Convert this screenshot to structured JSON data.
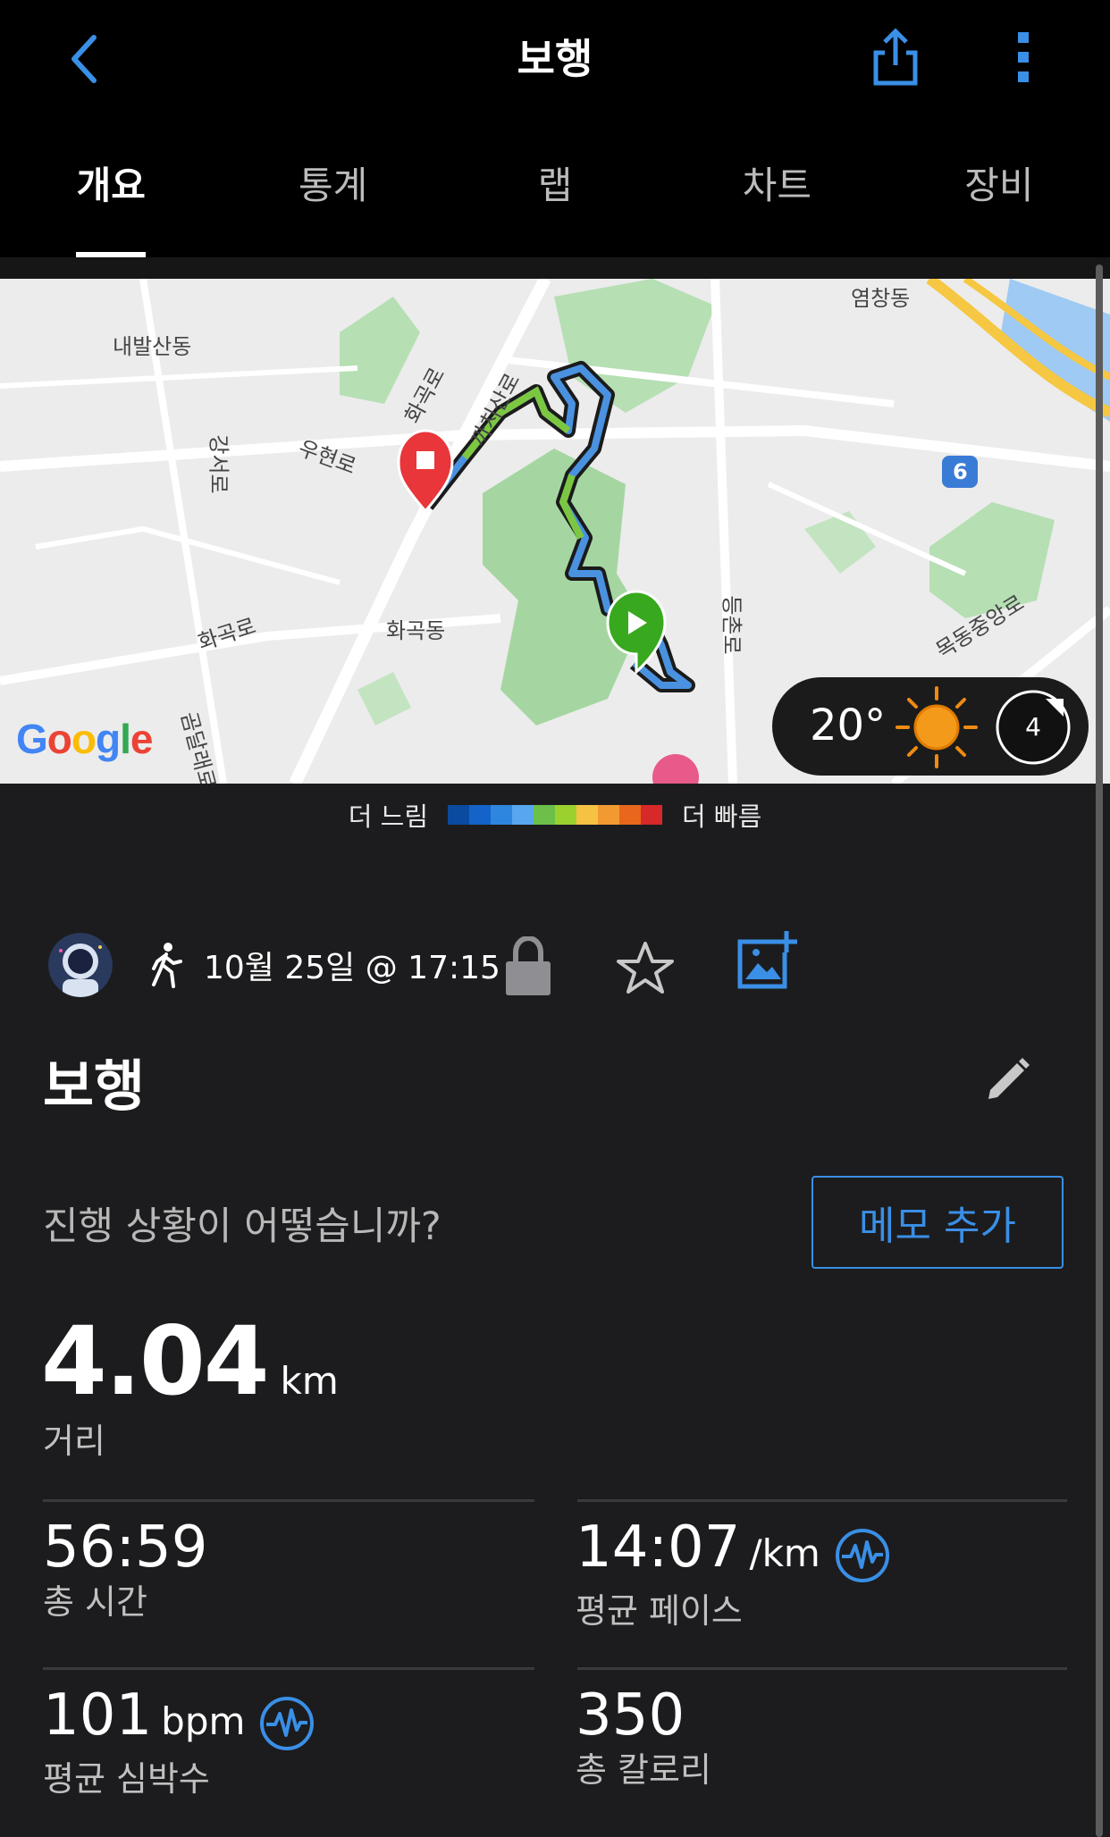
{
  "header": {
    "title": "보행",
    "tabs": [
      "개요",
      "통계",
      "랩",
      "차트",
      "장비"
    ],
    "active_tab": 0
  },
  "map": {
    "place_labels": [
      "내발산동",
      "강서로",
      "우현로",
      "화곡로",
      "화곡로",
      "화곡동",
      "까치산로",
      "염창동",
      "등촌로",
      "목동중앙로",
      "곰달래로",
      "6"
    ],
    "weather": {
      "temperature": "20°",
      "wind_speed": "4"
    },
    "attribution": "Google"
  },
  "legend": {
    "slower": "더 느림",
    "faster": "더 빠름",
    "colors": [
      "#0a4a9f",
      "#1363c9",
      "#2e86de",
      "#57a6ee",
      "#6cc04a",
      "#9ad12f",
      "#f5c244",
      "#f29a31",
      "#e8671c",
      "#d7282a"
    ]
  },
  "activity": {
    "date_time": "10월 25일 @ 17:15",
    "name": "보행",
    "prompt": "진행 상황이 어떻습니까?",
    "memo_button": "메모 추가"
  },
  "distance": {
    "value": "4.04",
    "unit": "km",
    "label": "거리"
  },
  "stats": [
    {
      "value": "56:59",
      "unit": "",
      "label": "총 시간",
      "icon": ""
    },
    {
      "value": "14:07",
      "unit": "/km",
      "label": "평균 페이스",
      "icon": "heart-rate-icon"
    },
    {
      "value": "101",
      "unit": "bpm",
      "label": "평균 심박수",
      "icon": "heart-rate-icon"
    },
    {
      "value": "350",
      "unit": "",
      "label": "총 칼로리",
      "icon": ""
    }
  ],
  "colors": {
    "accent": "#3a8fe6",
    "background": "#1c1c1e",
    "bar": "#000000"
  }
}
